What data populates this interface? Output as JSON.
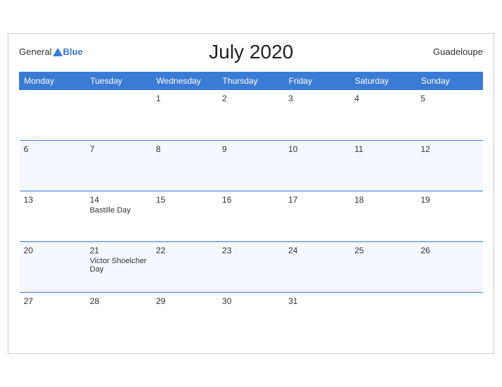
{
  "header": {
    "logo_general": "General",
    "logo_blue": "Blue",
    "title": "July 2020",
    "region": "Guadeloupe"
  },
  "weekdays": [
    "Monday",
    "Tuesday",
    "Wednesday",
    "Thursday",
    "Friday",
    "Saturday",
    "Sunday"
  ],
  "weeks": [
    [
      {
        "day": "",
        "empty": true
      },
      {
        "day": "",
        "empty": true
      },
      {
        "day": "1",
        "empty": false
      },
      {
        "day": "2",
        "empty": false
      },
      {
        "day": "3",
        "empty": false
      },
      {
        "day": "4",
        "empty": false
      },
      {
        "day": "5",
        "empty": false
      }
    ],
    [
      {
        "day": "6",
        "empty": false
      },
      {
        "day": "7",
        "empty": false
      },
      {
        "day": "8",
        "empty": false
      },
      {
        "day": "9",
        "empty": false
      },
      {
        "day": "10",
        "empty": false
      },
      {
        "day": "11",
        "empty": false
      },
      {
        "day": "12",
        "empty": false
      }
    ],
    [
      {
        "day": "13",
        "empty": false
      },
      {
        "day": "14",
        "empty": false,
        "holiday": "Bastille Day"
      },
      {
        "day": "15",
        "empty": false
      },
      {
        "day": "16",
        "empty": false
      },
      {
        "day": "17",
        "empty": false
      },
      {
        "day": "18",
        "empty": false
      },
      {
        "day": "19",
        "empty": false
      }
    ],
    [
      {
        "day": "20",
        "empty": false
      },
      {
        "day": "21",
        "empty": false,
        "holiday": "Victor Shoelcher Day"
      },
      {
        "day": "22",
        "empty": false
      },
      {
        "day": "23",
        "empty": false
      },
      {
        "day": "24",
        "empty": false
      },
      {
        "day": "25",
        "empty": false
      },
      {
        "day": "26",
        "empty": false
      }
    ],
    [
      {
        "day": "27",
        "empty": false
      },
      {
        "day": "28",
        "empty": false
      },
      {
        "day": "29",
        "empty": false
      },
      {
        "day": "30",
        "empty": false
      },
      {
        "day": "31",
        "empty": false
      },
      {
        "day": "",
        "empty": true
      },
      {
        "day": "",
        "empty": true
      }
    ]
  ]
}
